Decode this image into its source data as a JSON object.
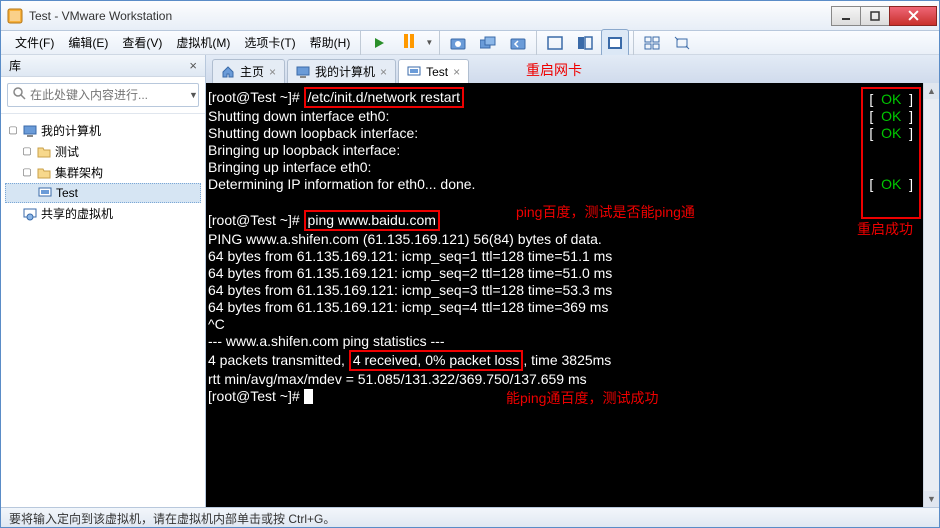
{
  "title": "Test - VMware Workstation",
  "menus": {
    "file": "文件(F)",
    "edit": "编辑(E)",
    "view": "查看(V)",
    "vm": "虚拟机(M)",
    "tabs": "选项卡(T)",
    "help": "帮助(H)"
  },
  "sidebar": {
    "header": "库",
    "search_placeholder": "在此处键入内容进行...",
    "tree": {
      "mycomputer": "我的计算机",
      "test_folder": "测试",
      "cluster": "集群架构",
      "test_vm": "Test",
      "shared": "共享的虚拟机"
    }
  },
  "tabs": {
    "home": "主页",
    "mycomputer": "我的计算机",
    "test": "Test"
  },
  "annotations": {
    "restart_nic": "重启网卡",
    "ping_test": "ping百度，测试是否能ping通",
    "restart_ok": "重启成功",
    "ping_ok": "能ping通百度，测试成功"
  },
  "terminal": {
    "p1_pre": "[root@Test ~]# ",
    "cmd1": "/etc/init.d/network restart",
    "l2": "Shutting down interface eth0:",
    "l3": "Shutting down loopback interface:",
    "l4": "Bringing up loopback interface:",
    "l5": "Bringing up interface eth0:",
    "l6": "Determining IP information for eth0... done.",
    "p2_pre": "[root@Test ~]# ",
    "cmd2": "ping www.baidu.com",
    "l8": "PING www.a.shifen.com (61.135.169.121) 56(84) bytes of data.",
    "l9": "64 bytes from 61.135.169.121: icmp_seq=1 ttl=128 time=51.1 ms",
    "l10": "64 bytes from 61.135.169.121: icmp_seq=2 ttl=128 time=51.0 ms",
    "l11": "64 bytes from 61.135.169.121: icmp_seq=3 ttl=128 time=53.3 ms",
    "l12": "64 bytes from 61.135.169.121: icmp_seq=4 ttl=128 time=369 ms",
    "l13": "^C",
    "l14": "--- www.a.shifen.com ping statistics ---",
    "l15a": "4 packets transmitted, ",
    "l15b": "4 received, 0% packet loss",
    "l15c": ", time 3825ms",
    "l16": "rtt min/avg/max/mdev = 51.085/131.322/369.750/137.659 ms",
    "p3": "[root@Test ~]# ",
    "ok": "OK"
  },
  "statusbar": "要将输入定向到该虚拟机，请在虚拟机内部单击或按 Ctrl+G。"
}
